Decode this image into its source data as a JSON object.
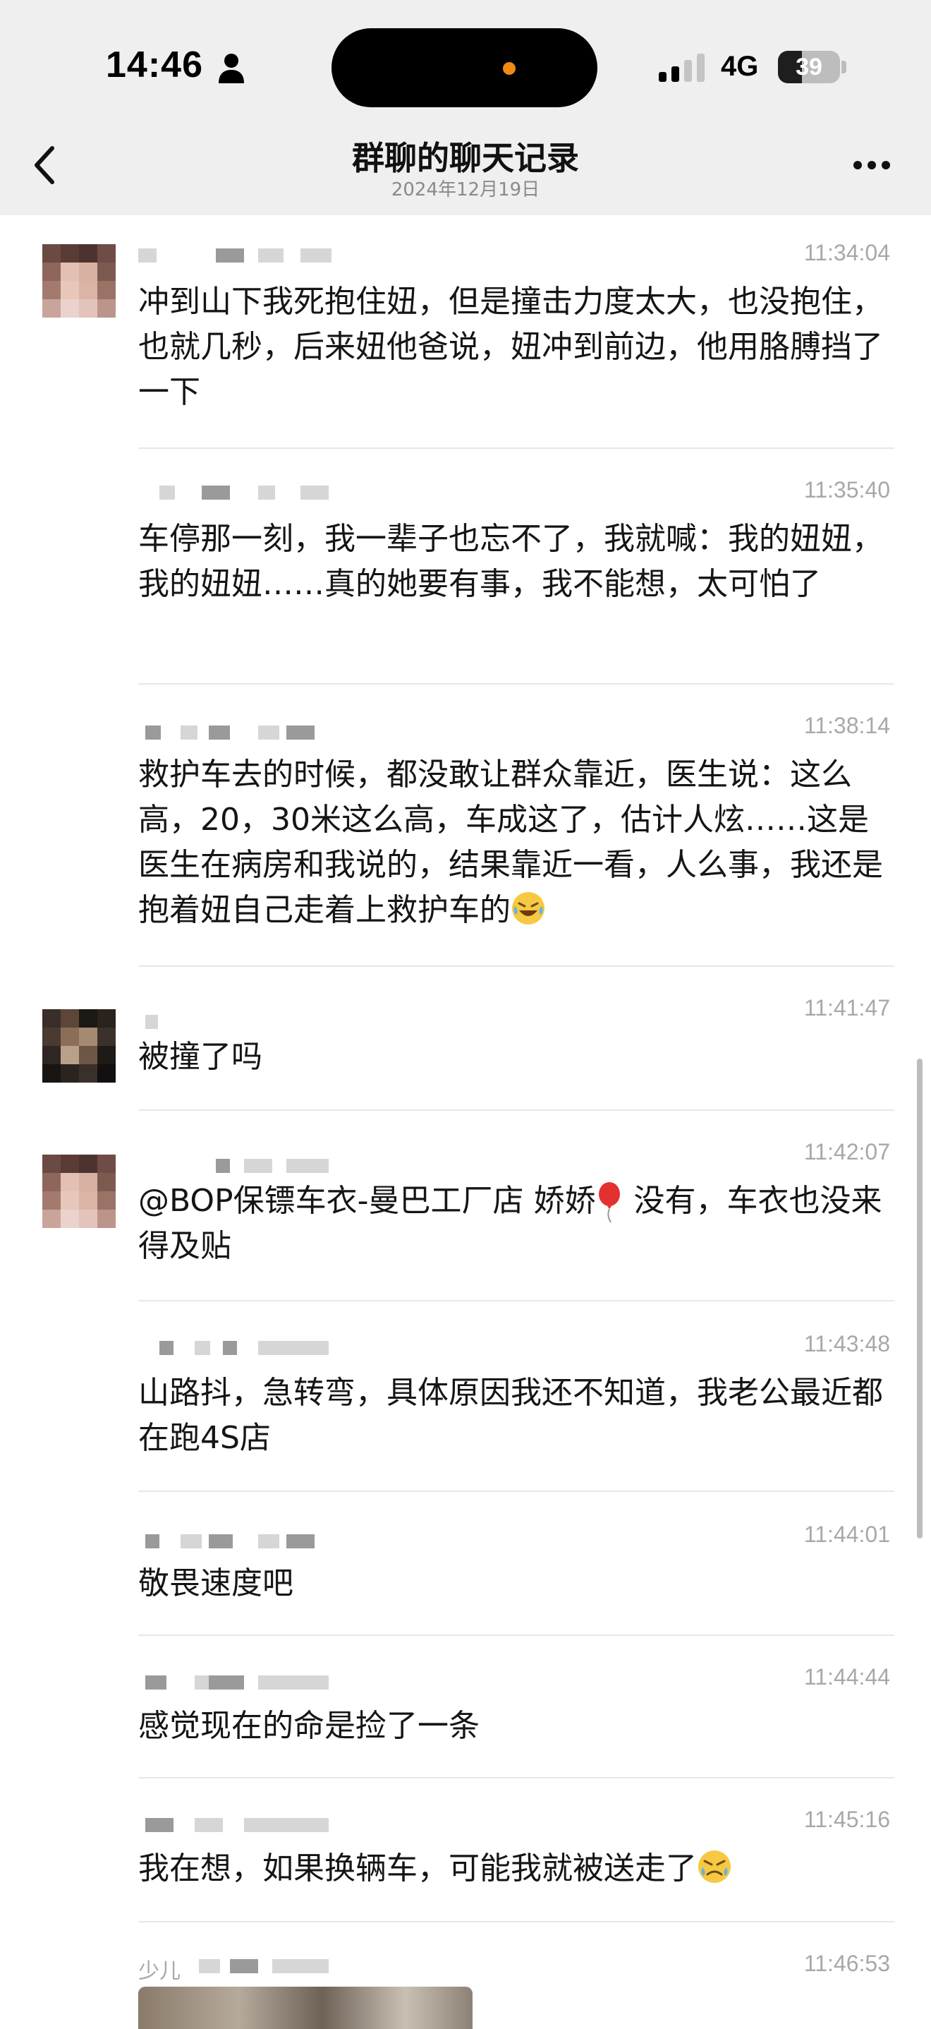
{
  "status_bar": {
    "time": "14:46",
    "network": "4G",
    "battery": "39",
    "battery_level_percent": 39,
    "island_dot_color": "#f08a16"
  },
  "nav": {
    "back_icon": "chevron-left-icon",
    "title": "群聊的聊天记录",
    "subtitle": "2024年12月19日",
    "more_icon": "ellipsis-icon"
  },
  "messages": [
    {
      "sender": "",
      "time": "11:34:04",
      "text": "冲到山下我死抱住妞，但是撞击力度太大，也没抱住，也就几秒，后来妞他爸说，妞冲到前边，他用胳膊挡了一下"
    },
    {
      "sender": "",
      "time": "11:35:40",
      "text": "车停那一刻，我一辈子也忘不了，我就喊：我的妞妞，我的妞妞……真的她要有事，我不能想，太可怕了"
    },
    {
      "sender": "",
      "time": "11:38:14",
      "text": "救护车去的时候，都没敢让群众靠近，医生说：这么高，20，30米这么高，车成这了，估计人炫……这是医生在病房和我说的，结果靠近一看，人么事，我还是抱着妞自己走着上救护车的"
    },
    {
      "sender": "",
      "time": "11:41:47",
      "text": "被撞了吗"
    },
    {
      "sender": "",
      "time": "11:42:07",
      "text_mention": "@BOP保镖车衣-曼巴工厂店 娇娇",
      "text": " 没有，车衣也没来得及贴"
    },
    {
      "sender": "",
      "time": "11:43:48",
      "text": "山路抖，急转弯，具体原因我还不知道，我老公最近都在跑4S店"
    },
    {
      "sender": "",
      "time": "11:44:01",
      "text": "敬畏速度吧"
    },
    {
      "sender": "",
      "time": "11:44:44",
      "text": "感觉现在的命是捡了一条"
    },
    {
      "sender": "",
      "time": "11:45:16",
      "text": "我在想，如果换辆车，可能我就被送走了"
    },
    {
      "sender": "少儿",
      "time": "11:46:53",
      "text": ""
    }
  ]
}
